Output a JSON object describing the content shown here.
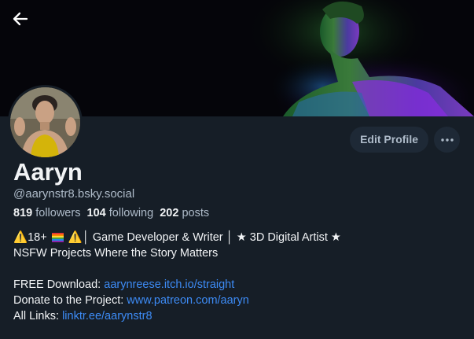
{
  "profile": {
    "display_name": "Aaryn",
    "handle": "@aarynstr8.bsky.social",
    "stats": {
      "followers_count": "819",
      "followers_label": "followers",
      "following_count": "104",
      "following_label": "following",
      "posts_count": "202",
      "posts_label": "posts"
    }
  },
  "actions": {
    "edit_label": "Edit Profile",
    "more_icon": "ellipsis-icon"
  },
  "nav": {
    "back_icon": "arrow-left-icon"
  },
  "bio": {
    "line1_warning_a": "⚠️",
    "line1_age": "18+",
    "line1_flag": "rainbow-flag-icon",
    "line1_warning_b": "⚠️",
    "line1_text": "│ Game Developer & Writer │ ★ 3D Digital Artist ★",
    "line2": "NSFW Projects Where the Story Matters",
    "download_label": "FREE Download:",
    "download_link": "aarynreese.itch.io/straight",
    "donate_label": "Donate to the Project:",
    "donate_link": "www.patreon.com/aaryn",
    "links_label": "All Links:",
    "links_link": "linktr.ee/aarynstr8"
  },
  "colors": {
    "background": "#161e27",
    "link": "#3d8bf5",
    "muted_text": "#aebbc9",
    "button_bg": "#1e2936"
  }
}
